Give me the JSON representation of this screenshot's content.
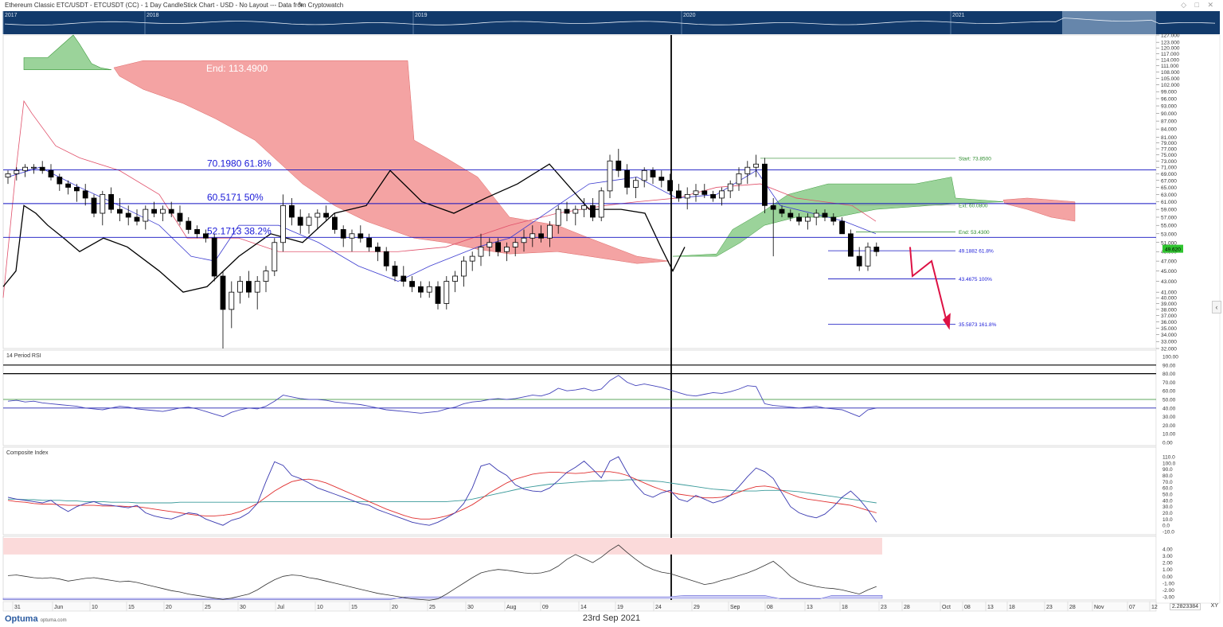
{
  "header": {
    "title": "Ethereum Classic ETC/USDT - ETCUSDT (CC) - 1 Day CandleStick Chart - USD - No Layout --- Data from Cryptowatch",
    "navigator_years": [
      "2017",
      "2018",
      "2019",
      "2020",
      "2021"
    ]
  },
  "footer": {
    "date": "23rd Sep 2021",
    "logo": "Optuma",
    "logo_url": "optuma.com",
    "corner_value": "2.2823384",
    "xy": "XY"
  },
  "colors": {
    "navigator_bg": "#123a6b",
    "cloud_bull": "#9bd39a",
    "cloud_bear": "#f4a3a3",
    "fib_line": "#1010c0",
    "fib_text": "#1a1ad8",
    "price_tag": "#2fc42f",
    "arrow": "#dd1144"
  },
  "annotations": {
    "end_label": "End:",
    "end_value": "113.4900",
    "fib_levels": [
      {
        "value": "70.1980",
        "pct": "61.8%"
      },
      {
        "value": "60.5171",
        "pct": "50%"
      },
      {
        "value": "52.1713",
        "pct": "38.2%"
      }
    ],
    "start_label": "Start: 73.8500",
    "ext_label": "Ext: 60.0800",
    "end2_label": "End: 53.4300",
    "ext_levels": [
      {
        "value": "49.1882",
        "pct": "61.8%"
      },
      {
        "value": "43.4675",
        "pct": "100%"
      },
      {
        "value": "35.5873",
        "pct": "161.8%"
      }
    ],
    "last_price": "49.620"
  },
  "price_axis": [
    "127.000",
    "123.000",
    "120.000",
    "117.000",
    "114.000",
    "111.000",
    "108.000",
    "105.000",
    "102.000",
    "99.000",
    "96.000",
    "93.000",
    "90.000",
    "87.000",
    "84.000",
    "81.000",
    "79.000",
    "77.000",
    "75.000",
    "73.000",
    "71.000",
    "69.000",
    "67.000",
    "65.000",
    "63.000",
    "61.000",
    "59.000",
    "57.000",
    "55.000",
    "53.000",
    "51.000",
    "49.000",
    "47.000",
    "45.000",
    "43.000",
    "41.000",
    "40.000",
    "39.000",
    "38.000",
    "37.000",
    "36.000",
    "35.000",
    "34.000",
    "33.000",
    "32.000"
  ],
  "x_axis_labels": [
    "31",
    "Jun",
    "10",
    "15",
    "20",
    "25",
    "30",
    "Jul",
    "10",
    "15",
    "20",
    "25",
    "30",
    "Aug",
    "09",
    "14",
    "19",
    "24",
    "29",
    "Sep",
    "08",
    "13",
    "18",
    "23",
    "28",
    "Oct",
    "08",
    "13",
    "18",
    "23",
    "28",
    "Nov",
    "07",
    "12"
  ],
  "panels": {
    "rsi": {
      "title": "14 Period RSI",
      "axis": [
        "100.00",
        "90.00",
        "80.00",
        "70.00",
        "60.00",
        "50.00",
        "40.00",
        "30.00",
        "20.00",
        "10.00",
        "0.00"
      ]
    },
    "composite": {
      "title": "Composite Index",
      "axis": [
        "110.0",
        "100.0",
        "90.0",
        "80.0",
        "70.0",
        "60.0",
        "50.0",
        "40.0",
        "30.0",
        "20.0",
        "10.0",
        "0.0",
        "-10.0"
      ]
    },
    "optex": {
      "title": "Optex Bands",
      "axis": [
        "4.00",
        "3.00",
        "2.00",
        "1.00",
        "0.00",
        "-1.00",
        "-2.00",
        "-3.00"
      ]
    }
  },
  "chart_data": {
    "type": "candlestick",
    "title": "Ethereum Classic ETC/USDT - ETCUSDT (CC) - 1 Day CandleStick Chart - USD",
    "y_range": [
      32,
      127
    ],
    "y_scale": "log",
    "candles": [
      [
        68,
        70,
        66,
        69
      ],
      [
        69,
        71,
        67,
        70
      ],
      [
        70,
        72,
        68,
        71
      ],
      [
        71,
        72,
        69,
        71
      ],
      [
        71,
        73,
        69,
        70
      ],
      [
        70,
        72,
        67,
        68
      ],
      [
        68,
        69,
        64,
        66
      ],
      [
        66,
        67,
        63,
        65
      ],
      [
        65,
        66,
        61,
        64
      ],
      [
        64,
        66,
        60,
        62
      ],
      [
        62,
        63,
        57,
        58
      ],
      [
        58,
        64,
        55,
        63
      ],
      [
        63,
        65,
        58,
        59
      ],
      [
        59,
        62,
        56,
        58
      ],
      [
        58,
        60,
        55,
        57
      ],
      [
        57,
        59,
        55,
        56
      ],
      [
        56,
        60,
        54,
        59
      ],
      [
        59,
        61,
        57,
        58
      ],
      [
        58,
        60,
        56,
        59
      ],
      [
        59,
        61,
        57,
        58
      ],
      [
        58,
        60,
        55,
        56
      ],
      [
        56,
        57,
        53,
        54
      ],
      [
        54,
        55,
        52,
        53
      ],
      [
        53,
        54,
        51,
        52
      ],
      [
        52,
        53,
        43,
        44
      ],
      [
        44,
        45,
        32,
        38
      ],
      [
        38,
        43,
        35,
        41
      ],
      [
        41,
        44,
        39,
        43
      ],
      [
        43,
        45,
        40,
        41
      ],
      [
        41,
        44,
        38,
        43
      ],
      [
        43,
        46,
        41,
        45
      ],
      [
        45,
        52,
        44,
        51
      ],
      [
        51,
        63,
        49,
        60
      ],
      [
        60,
        62,
        55,
        57
      ],
      [
        57,
        59,
        53,
        55
      ],
      [
        55,
        58,
        53,
        57
      ],
      [
        57,
        59,
        54,
        58
      ],
      [
        58,
        60,
        56,
        57
      ],
      [
        57,
        58,
        53,
        54
      ],
      [
        54,
        55,
        50,
        52
      ],
      [
        52,
        54,
        49,
        53
      ],
      [
        53,
        55,
        51,
        52
      ],
      [
        52,
        53,
        49,
        50
      ],
      [
        50,
        51,
        47,
        49
      ],
      [
        49,
        50,
        45,
        46
      ],
      [
        46,
        47,
        43,
        44
      ],
      [
        44,
        46,
        42,
        43
      ],
      [
        43,
        44,
        41,
        42
      ],
      [
        42,
        43,
        40,
        41
      ],
      [
        41,
        43,
        40,
        42
      ],
      [
        42,
        43,
        38,
        39
      ],
      [
        39,
        44,
        38,
        43
      ],
      [
        43,
        45,
        41,
        44
      ],
      [
        44,
        48,
        42,
        47
      ],
      [
        47,
        49,
        45,
        48
      ],
      [
        48,
        53,
        46,
        50
      ],
      [
        50,
        52,
        48,
        51
      ],
      [
        51,
        52,
        48,
        49
      ],
      [
        49,
        51,
        47,
        50
      ],
      [
        50,
        52,
        48,
        51
      ],
      [
        51,
        54,
        49,
        52
      ],
      [
        52,
        55,
        50,
        53
      ],
      [
        53,
        55,
        51,
        52
      ],
      [
        52,
        56,
        50,
        55
      ],
      [
        55,
        60,
        53,
        59
      ],
      [
        59,
        61,
        56,
        58
      ],
      [
        58,
        60,
        55,
        59
      ],
      [
        59,
        62,
        57,
        60
      ],
      [
        60,
        62,
        56,
        57
      ],
      [
        57,
        65,
        56,
        64
      ],
      [
        64,
        75,
        62,
        73
      ],
      [
        73,
        77,
        68,
        70
      ],
      [
        70,
        72,
        63,
        65
      ],
      [
        65,
        68,
        62,
        67
      ],
      [
        67,
        71,
        65,
        70
      ],
      [
        70,
        71,
        66,
        68
      ],
      [
        68,
        70,
        65,
        67
      ],
      [
        67,
        69,
        63,
        64
      ],
      [
        64,
        66,
        61,
        62
      ],
      [
        62,
        65,
        59,
        63
      ],
      [
        63,
        66,
        61,
        64
      ],
      [
        64,
        66,
        62,
        63
      ],
      [
        63,
        64,
        61,
        62
      ],
      [
        62,
        65,
        60,
        64
      ],
      [
        64,
        67,
        62,
        66
      ],
      [
        66,
        71,
        64,
        69
      ],
      [
        69,
        73,
        66,
        71
      ],
      [
        71,
        75,
        68,
        72
      ],
      [
        72,
        74,
        58,
        60
      ],
      [
        60,
        62,
        48,
        59
      ],
      [
        59,
        60,
        57,
        58
      ],
      [
        58,
        59,
        56,
        57
      ],
      [
        57,
        58,
        55,
        56
      ],
      [
        56,
        58,
        54,
        57
      ],
      [
        57,
        59,
        55,
        58
      ],
      [
        58,
        59,
        56,
        57
      ],
      [
        57,
        58,
        55,
        56
      ],
      [
        56,
        57,
        53,
        53
      ],
      [
        53,
        54,
        48,
        48
      ],
      [
        48,
        50,
        45,
        46
      ],
      [
        46,
        51,
        45,
        50
      ],
      [
        50,
        51,
        48,
        49
      ]
    ],
    "ichimoku_cloud_top_left": 113.49,
    "fib_retracements": [
      70.198,
      60.5171,
      52.1713
    ],
    "fib_extensions": [
      49.1882,
      43.4675,
      35.5873
    ],
    "extension_anchors": {
      "start": 73.85,
      "ext": 60.08,
      "end": 53.43
    },
    "last_price": 49.62,
    "rsi": [
      48,
      49,
      47,
      48,
      46,
      45,
      44,
      43,
      42,
      40,
      39,
      38,
      40,
      42,
      41,
      39,
      38,
      37,
      36,
      38,
      40,
      41,
      39,
      36,
      33,
      30,
      35,
      38,
      40,
      39,
      42,
      48,
      55,
      53,
      51,
      50,
      50,
      49,
      47,
      46,
      45,
      44,
      42,
      40,
      38,
      37,
      36,
      35,
      34,
      35,
      36,
      39,
      41,
      45,
      47,
      48,
      50,
      51,
      50,
      51,
      53,
      55,
      54,
      57,
      63,
      60,
      61,
      63,
      60,
      62,
      72,
      78,
      70,
      66,
      68,
      66,
      64,
      61,
      58,
      55,
      54,
      56,
      58,
      57,
      59,
      62,
      66,
      65,
      45,
      43,
      42,
      41,
      40,
      41,
      42,
      40,
      39,
      38,
      34,
      30,
      38,
      40
    ],
    "composite": [
      45,
      42,
      40,
      38,
      36,
      40,
      30,
      22,
      30,
      35,
      38,
      33,
      32,
      30,
      28,
      32,
      20,
      15,
      12,
      10,
      15,
      20,
      18,
      10,
      5,
      0,
      8,
      12,
      20,
      35,
      70,
      102,
      96,
      80,
      75,
      68,
      60,
      55,
      50,
      45,
      40,
      35,
      32,
      25,
      20,
      15,
      10,
      5,
      2,
      0,
      5,
      12,
      20,
      35,
      60,
      95,
      99,
      88,
      80,
      65,
      58,
      55,
      54,
      60,
      72,
      85,
      93,
      103,
      90,
      76,
      103,
      110,
      85,
      65,
      50,
      45,
      52,
      56,
      42,
      38,
      48,
      42,
      36,
      40,
      48,
      62,
      78,
      92,
      86,
      75,
      52,
      30,
      20,
      15,
      12,
      18,
      30,
      45,
      55,
      42,
      25,
      5
    ],
    "composite_ma_fast": [
      40,
      38,
      37,
      35,
      34,
      34,
      33,
      32,
      32,
      32,
      32,
      31,
      31,
      31,
      30,
      30,
      28,
      26,
      24,
      22,
      20,
      18,
      16,
      15,
      15,
      16,
      18,
      22,
      28,
      35,
      45,
      55,
      63,
      70,
      73,
      74,
      72,
      68,
      62,
      56,
      50,
      44,
      38,
      32,
      26,
      21,
      16,
      12,
      10,
      10,
      12,
      15,
      20,
      26,
      33,
      42,
      52,
      60,
      68,
      74,
      78,
      82,
      84,
      85,
      85,
      84,
      83,
      84,
      86,
      86,
      86,
      84,
      80,
      74,
      68,
      62,
      57,
      53,
      50,
      48,
      46,
      44,
      44,
      45,
      48,
      53,
      58,
      62,
      63,
      61,
      56,
      50,
      45,
      42,
      40,
      38,
      36,
      34,
      32,
      28,
      24,
      20
    ],
    "composite_ma_slow": [
      42,
      42,
      41,
      41,
      40,
      40,
      40,
      39,
      39,
      38,
      38,
      38,
      37,
      37,
      37,
      36,
      36,
      36,
      36,
      36,
      37,
      37,
      37,
      37,
      37,
      37,
      37,
      37,
      37,
      37,
      38,
      38,
      38,
      38,
      38,
      38,
      38,
      38,
      38,
      38,
      38,
      38,
      38,
      38,
      38,
      38,
      38,
      38,
      38,
      38,
      38,
      38,
      39,
      40,
      42,
      45,
      48,
      51,
      54,
      57,
      60,
      62,
      64,
      66,
      67,
      68,
      69,
      70,
      71,
      71,
      72,
      72,
      73,
      73,
      72,
      71,
      70,
      68,
      66,
      64,
      62,
      60,
      58,
      57,
      56,
      55,
      55,
      55,
      56,
      56,
      56,
      55,
      54,
      52,
      50,
      48,
      46,
      44,
      42,
      40,
      38,
      36
    ],
    "optex": [
      0.1,
      0.2,
      0.0,
      -0.2,
      -0.3,
      -0.2,
      -0.4,
      -0.7,
      -0.5,
      -0.3,
      -0.2,
      -0.4,
      -0.6,
      -0.8,
      -0.7,
      -0.9,
      -1.2,
      -1.5,
      -1.8,
      -2.1,
      -2.3,
      -2.6,
      -2.8,
      -3.0,
      -3.2,
      -3.4,
      -3.2,
      -2.9,
      -2.6,
      -2.0,
      -1.2,
      -0.5,
      0.0,
      0.2,
      0.1,
      -0.2,
      -0.4,
      -0.7,
      -1.0,
      -1.3,
      -1.6,
      -1.9,
      -2.2,
      -2.5,
      -2.7,
      -2.9,
      -3.1,
      -3.3,
      -3.4,
      -3.5,
      -3.3,
      -2.6,
      -1.8,
      -1.0,
      -0.2,
      0.5,
      0.8,
      1.0,
      0.9,
      0.7,
      0.5,
      0.4,
      0.5,
      0.8,
      1.5,
      2.5,
      3.2,
      2.6,
      2.0,
      2.8,
      3.8,
      4.6,
      3.5,
      2.5,
      1.6,
      1.0,
      0.6,
      0.4,
      0.0,
      -0.4,
      -0.8,
      -1.2,
      -1.0,
      -0.6,
      -0.3,
      0.1,
      0.5,
      1.0,
      1.6,
      2.2,
      1.2,
      0.0,
      -0.8,
      -1.2,
      -1.5,
      -1.7,
      -1.8,
      -2.0,
      -2.3,
      -2.6,
      -2.0,
      -1.5
    ]
  }
}
